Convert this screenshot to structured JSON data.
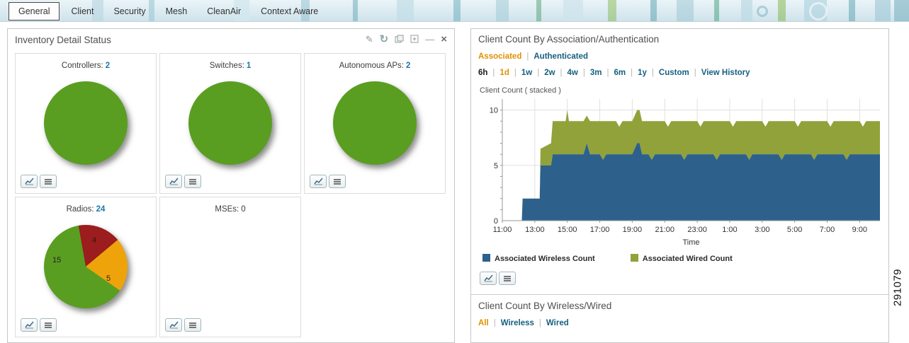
{
  "figure_number": "291079",
  "icons": {
    "edit_glyph": "✎",
    "refresh_glyph": "↻",
    "minimize_glyph": "—",
    "close_glyph": "×"
  },
  "tabs": [
    {
      "label": "General",
      "selected": true
    },
    {
      "label": "Client"
    },
    {
      "label": "Security"
    },
    {
      "label": "Mesh"
    },
    {
      "label": "CleanAir"
    },
    {
      "label": "Context Aware"
    }
  ],
  "inventory": {
    "title": "Inventory Detail Status",
    "tiles": [
      {
        "label": "Controllers:",
        "value": "2"
      },
      {
        "label": "Switches:",
        "value": "1"
      },
      {
        "label": "Autonomous APs:",
        "value": "2"
      },
      {
        "label": "Radios:",
        "value": "24"
      },
      {
        "label": "MSEs:",
        "value": "0"
      }
    ]
  },
  "assoc_widget": {
    "title": "Client Count By Association/Authentication",
    "mode_links": [
      "Associated",
      "Authenticated"
    ],
    "range_links": [
      "6h",
      "1d",
      "1w",
      "2w",
      "4w",
      "3m",
      "6m",
      "1y",
      "Custom",
      "View History"
    ]
  },
  "wireless_widget": {
    "title": "Client Count By Wireless/Wired",
    "links": [
      "All",
      "Wireless",
      "Wired"
    ]
  },
  "chart_data": [
    {
      "type": "pie",
      "title": "Controllers",
      "slices": [
        {
          "label": "Controllers",
          "value": 2,
          "color": "#5a9e21"
        }
      ]
    },
    {
      "type": "pie",
      "title": "Switches",
      "slices": [
        {
          "label": "Switches",
          "value": 1,
          "color": "#5a9e21"
        }
      ]
    },
    {
      "type": "pie",
      "title": "Autonomous APs",
      "slices": [
        {
          "label": "Autonomous APs",
          "value": 2,
          "color": "#5a9e21"
        }
      ]
    },
    {
      "type": "pie",
      "title": "Radios",
      "start_angle": -10,
      "slices": [
        {
          "label": "4",
          "value": 4,
          "color": "#9b1d1d"
        },
        {
          "label": "5",
          "value": 5,
          "color": "#efa30a"
        },
        {
          "label": "15",
          "value": 15,
          "color": "#5a9e21"
        }
      ]
    },
    {
      "type": "area",
      "stacked": true,
      "title": "Client Count ( stacked )",
      "xlabel": "Time",
      "ylim": [
        0,
        11
      ],
      "yticks": [
        0,
        5,
        10
      ],
      "x_ticks": [
        {
          "t": 0,
          "label": "11:00"
        },
        {
          "t": 2,
          "label": "13:00"
        },
        {
          "t": 4,
          "label": "15:00"
        },
        {
          "t": 6,
          "label": "17:00"
        },
        {
          "t": 8,
          "label": "19:00"
        },
        {
          "t": 10,
          "label": "21:00"
        },
        {
          "t": 12,
          "label": "23:00"
        },
        {
          "t": 14,
          "label": "1:00"
        },
        {
          "t": 16,
          "label": "3:00"
        },
        {
          "t": 18,
          "label": "5:00"
        },
        {
          "t": 20,
          "label": "7:00"
        },
        {
          "t": 22,
          "label": "9:00"
        }
      ],
      "x": [
        0,
        1.2,
        1.25,
        2.3,
        2.35,
        3.0,
        3.1,
        3.5,
        3.9,
        4.0,
        4.1,
        4.5,
        5.0,
        5.2,
        5.4,
        6.0,
        6.2,
        6.4,
        7.0,
        7.2,
        7.4,
        8.0,
        8.3,
        8.45,
        8.6,
        9.0,
        9.2,
        9.4,
        10.0,
        10.2,
        10.4,
        11.0,
        11.2,
        11.4,
        12.0,
        12.2,
        12.4,
        13.0,
        13.2,
        13.4,
        14.0,
        14.2,
        14.4,
        15.0,
        15.2,
        15.4,
        16.0,
        16.2,
        16.4,
        17.0,
        17.2,
        17.4,
        18.0,
        18.2,
        18.4,
        19.0,
        19.2,
        19.4,
        20.0,
        20.2,
        20.4,
        21.0,
        21.2,
        21.4,
        22.0,
        22.2,
        22.4,
        23.0,
        23.25
      ],
      "series": [
        {
          "name": "Associated Wireless Count",
          "color": "#2d618c",
          "values": [
            0,
            0,
            2,
            2,
            5,
            5,
            6,
            6,
            6,
            6,
            6,
            6,
            6,
            7,
            6,
            6,
            5.5,
            6,
            6,
            6,
            6,
            6,
            7,
            7,
            6,
            6,
            5.5,
            6,
            6,
            6,
            6,
            6,
            5.5,
            6,
            6,
            6,
            6,
            6,
            5.5,
            6,
            6,
            6,
            6,
            6,
            5.5,
            6,
            6,
            6,
            6,
            6,
            5.5,
            6,
            6,
            6,
            6,
            6,
            5.5,
            6,
            6,
            6,
            6,
            6,
            5.5,
            6,
            6,
            6,
            6,
            6,
            6
          ]
        },
        {
          "name": "Associated Wired Count",
          "color": "#91a23a",
          "values": [
            0,
            0,
            0,
            0,
            1.5,
            2,
            3,
            3,
            3,
            4,
            3,
            3,
            3,
            2.5,
            3,
            3,
            3.5,
            3,
            3,
            2.5,
            3,
            3,
            3,
            3,
            3,
            3,
            3.5,
            3,
            3,
            2.5,
            3,
            3,
            3.5,
            3,
            3,
            2.5,
            3,
            3,
            3.5,
            3,
            3,
            2.5,
            3,
            3,
            3.5,
            3,
            3,
            2.5,
            3,
            3,
            3.5,
            3,
            3,
            2.5,
            3,
            3,
            3.5,
            3,
            3,
            2.5,
            3,
            3,
            3.5,
            3,
            3,
            2.5,
            3,
            3,
            3
          ]
        }
      ]
    }
  ]
}
